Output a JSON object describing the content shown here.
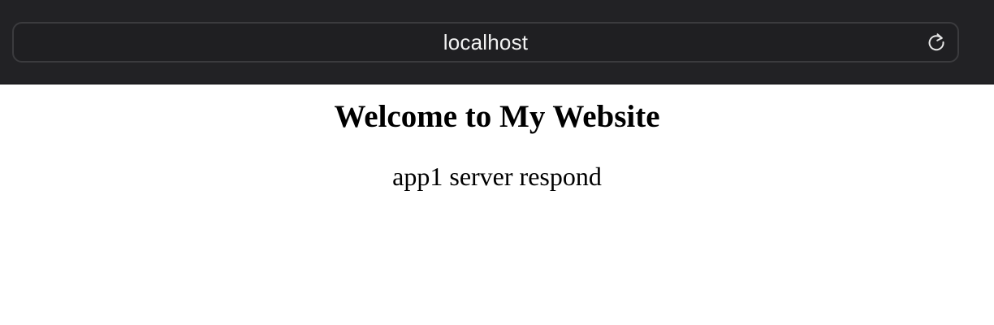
{
  "browser": {
    "address": "localhost",
    "reload_icon": "reload-icon"
  },
  "page": {
    "heading": "Welcome to My Website",
    "message": "app1 server respond"
  }
}
